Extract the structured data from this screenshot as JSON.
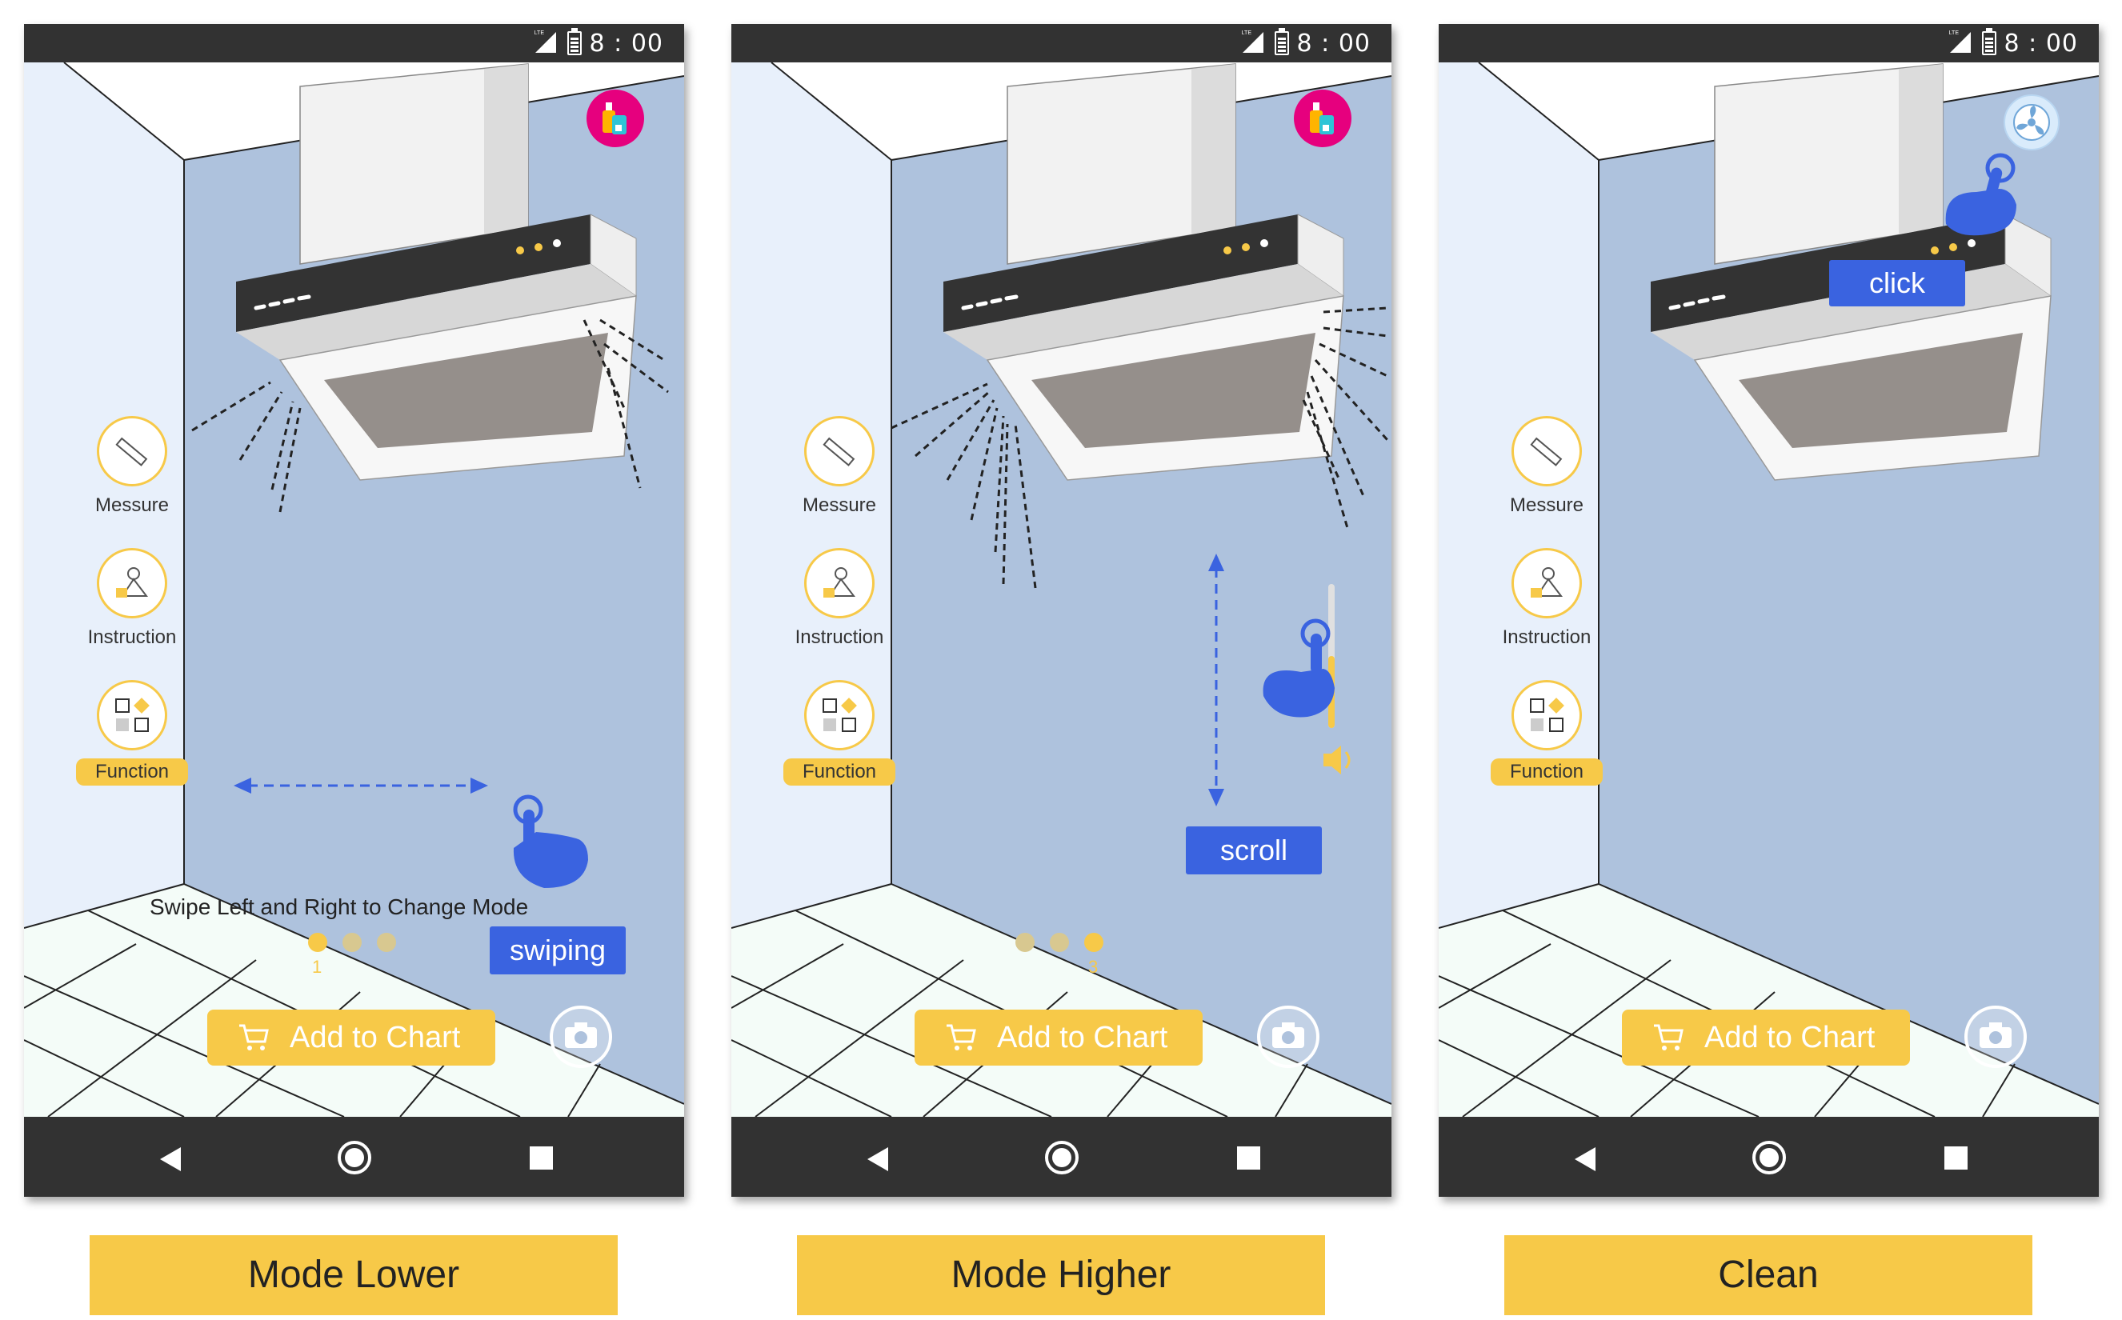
{
  "panels": [
    {
      "status_time": "8 : 00",
      "status_lte": "LTE",
      "tools": [
        "Messure",
        "Instruction",
        "Function"
      ],
      "hint_text": "Swipe Left and Right to Change Mode",
      "action_label": "swiping",
      "page_indicator": "1",
      "add_to_chart": "Add to Chart",
      "caption": "Mode Lower",
      "mode_icon": "detergent-bottles-icon"
    },
    {
      "status_time": "8 : 00",
      "status_lte": "LTE",
      "tools": [
        "Messure",
        "Instruction",
        "Function"
      ],
      "action_label": "scroll",
      "page_indicator": "3",
      "add_to_chart": "Add to Chart",
      "caption": "Mode Higher",
      "mode_icon": "detergent-bottles-icon"
    },
    {
      "status_time": "8 : 00",
      "status_lte": "LTE",
      "tools": [
        "Messure",
        "Instruction",
        "Function"
      ],
      "action_label": "click",
      "add_to_chart": "Add to Chart",
      "caption": "Clean",
      "mode_icon": "fan-clean-icon"
    }
  ],
  "colors": {
    "accent_yellow": "#f7c948",
    "action_blue": "#3a63e0",
    "wall_blue": "#aec2dd",
    "bar_dark": "#323232"
  }
}
